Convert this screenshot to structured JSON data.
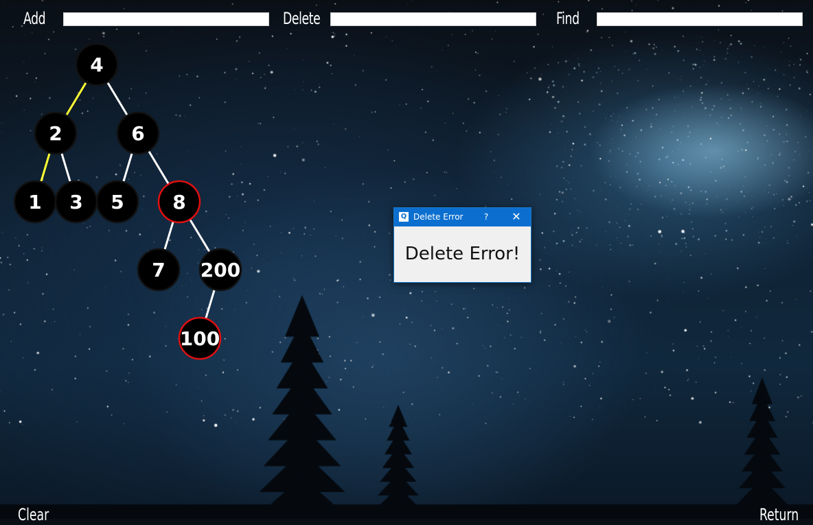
{
  "toolbar": {
    "add_label": "Add",
    "delete_label": "Delete",
    "find_label": "Find",
    "add_value": "",
    "delete_value": "",
    "find_value": ""
  },
  "bottom": {
    "clear_label": "Clear",
    "return_label": "Return"
  },
  "tree": {
    "nodes": [
      {
        "id": "n4",
        "label": "4",
        "state": "normal"
      },
      {
        "id": "n2",
        "label": "2",
        "state": "normal"
      },
      {
        "id": "n6",
        "label": "6",
        "state": "normal"
      },
      {
        "id": "n1",
        "label": "1",
        "state": "normal"
      },
      {
        "id": "n3",
        "label": "3",
        "state": "normal"
      },
      {
        "id": "n5",
        "label": "5",
        "state": "normal"
      },
      {
        "id": "n8",
        "label": "8",
        "state": "highlighted"
      },
      {
        "id": "n7",
        "label": "7",
        "state": "normal"
      },
      {
        "id": "n200",
        "label": "200",
        "state": "normal"
      },
      {
        "id": "n100",
        "label": "100",
        "state": "highlighted"
      }
    ],
    "edges": [
      {
        "from": "n4",
        "to": "n2",
        "color": "#ffff33"
      },
      {
        "from": "n4",
        "to": "n6",
        "color": "#ffffff"
      },
      {
        "from": "n2",
        "to": "n1",
        "color": "#ffff33"
      },
      {
        "from": "n2",
        "to": "n3",
        "color": "#ffffff"
      },
      {
        "from": "n6",
        "to": "n5",
        "color": "#ffffff"
      },
      {
        "from": "n6",
        "to": "n8",
        "color": "#ffffff"
      },
      {
        "from": "n8",
        "to": "n7",
        "color": "#ffffff"
      },
      {
        "from": "n8",
        "to": "n200",
        "color": "#ffffff"
      },
      {
        "from": "n200",
        "to": "n100",
        "color": "#ffffff"
      }
    ],
    "colors": {
      "normal_border": "#111111",
      "highlight_border": "#e01010"
    }
  },
  "dialog": {
    "title": "Delete Error",
    "help": "?",
    "close_icon": "close-icon",
    "message": "Delete Error!"
  }
}
